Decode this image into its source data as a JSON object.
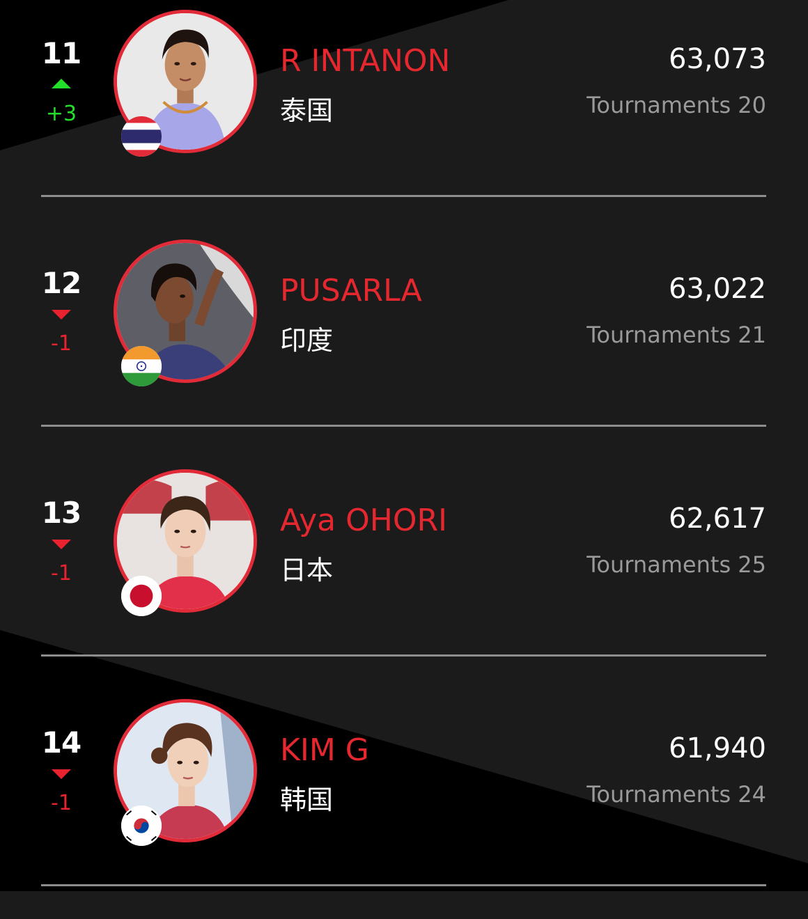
{
  "colors": {
    "accent": "#e5282f",
    "rank_up": "#22e02a",
    "rank_down": "#e8232f",
    "muted_text": "#9a9a9a",
    "background": "#1b1b1b"
  },
  "players": [
    {
      "rank": "11",
      "movement": "up",
      "change": "+3",
      "name": "R INTANON",
      "country": "泰国",
      "flag_icon": "thailand-flag-icon",
      "points": "63,073",
      "tournaments": "Tournaments 20"
    },
    {
      "rank": "12",
      "movement": "down",
      "change": "-1",
      "name": "PUSARLA",
      "country": "印度",
      "flag_icon": "india-flag-icon",
      "points": "63,022",
      "tournaments": "Tournaments 21"
    },
    {
      "rank": "13",
      "movement": "down",
      "change": "-1",
      "name": "Aya OHORI",
      "country": "日本",
      "flag_icon": "japan-flag-icon",
      "points": "62,617",
      "tournaments": "Tournaments 25"
    },
    {
      "rank": "14",
      "movement": "down",
      "change": "-1",
      "name": "KIM G",
      "country": "韩国",
      "flag_icon": "south-korea-flag-icon",
      "points": "61,940",
      "tournaments": "Tournaments 24"
    }
  ]
}
